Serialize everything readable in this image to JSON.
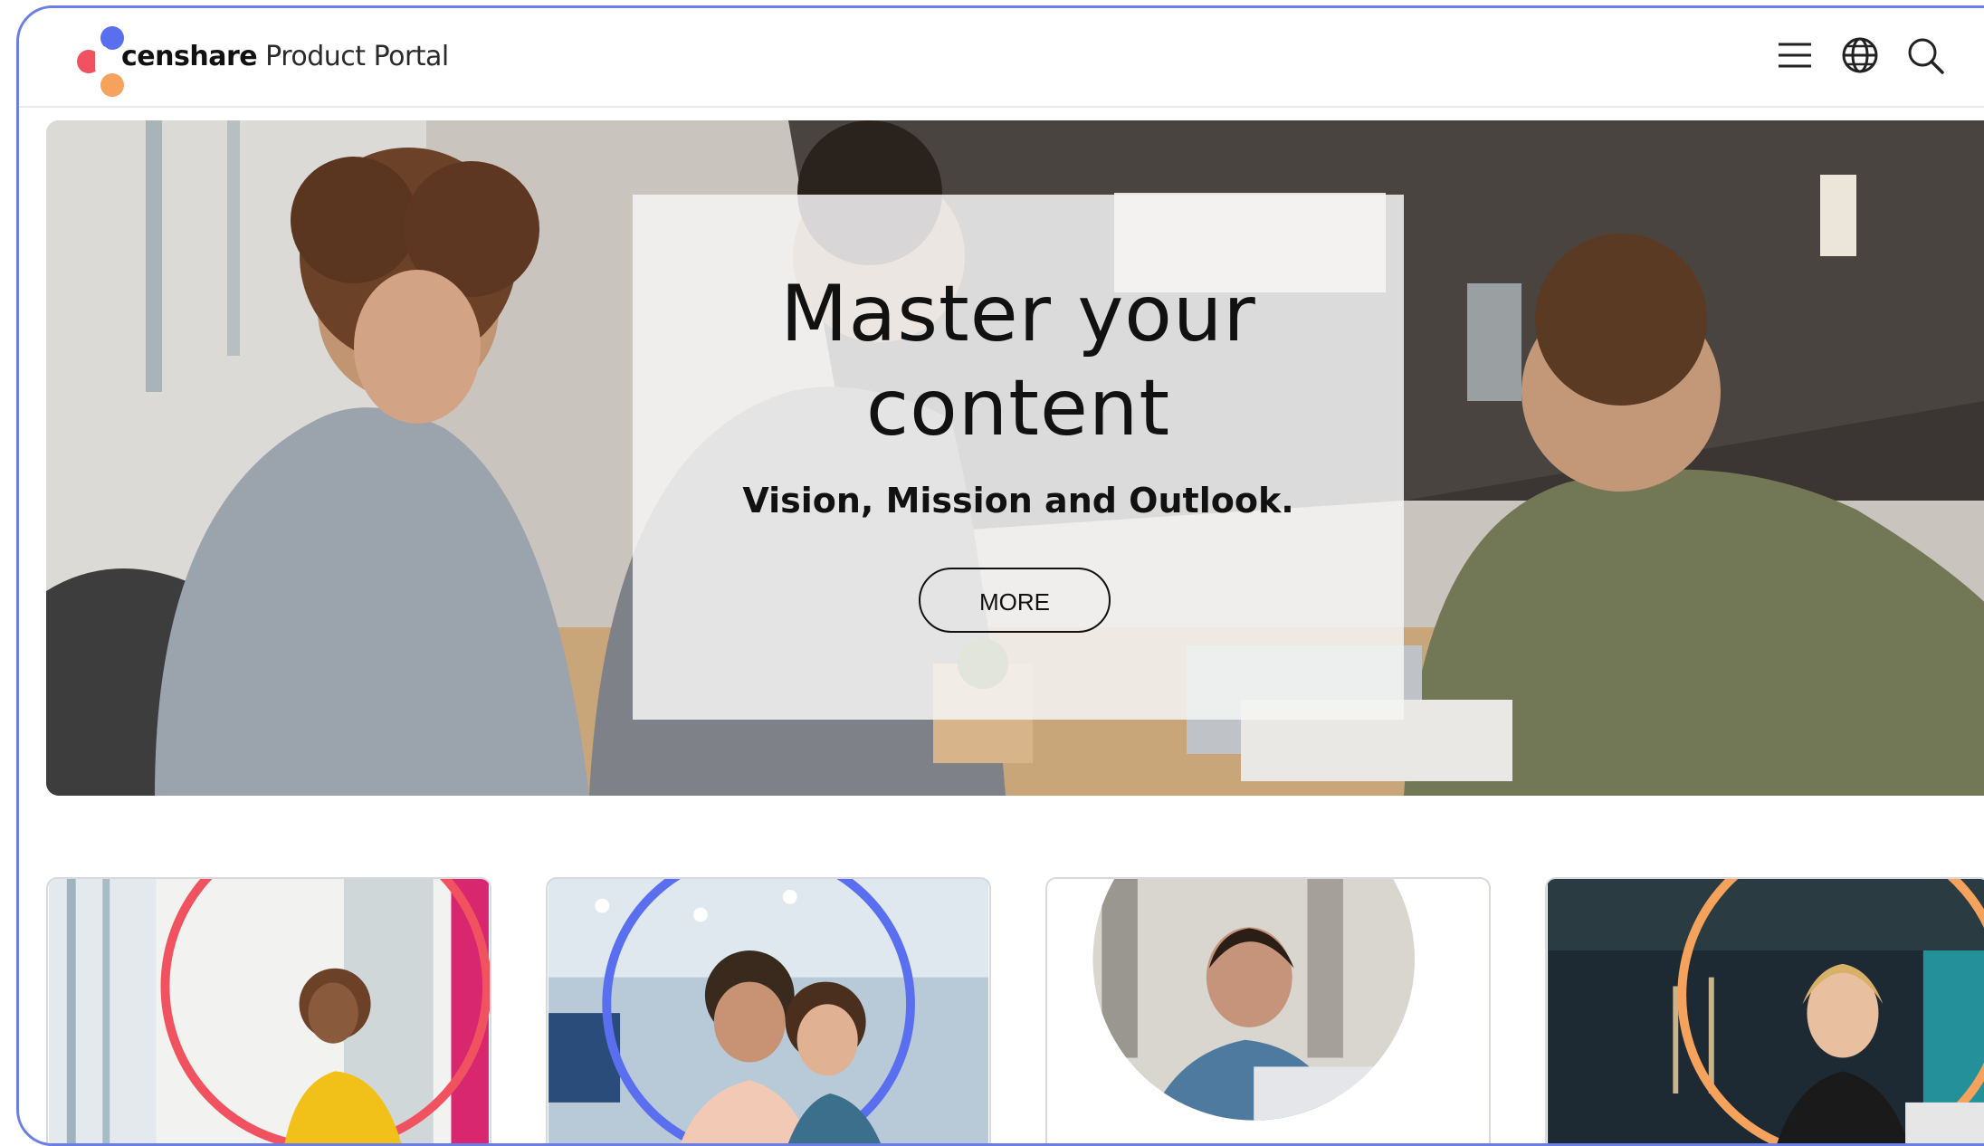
{
  "header": {
    "brand_bold": "censhare",
    "brand_light": " Product Portal",
    "icons": [
      "hamburger-menu-icon",
      "globe-icon",
      "search-icon"
    ]
  },
  "hero": {
    "title_line1": "Master your",
    "title_line2": "content",
    "subtitle": "Vision, Mission and Outlook.",
    "button_label": "MORE"
  },
  "tiles": [
    {
      "image": "woman-on-phone-photo",
      "accent": "#f0535f"
    },
    {
      "image": "couple-with-phone-photo",
      "accent": "#5a6ff0"
    },
    {
      "image": "man-with-laptop-photo",
      "accent": "#ffffff"
    },
    {
      "image": "woman-at-laptop-photo",
      "accent": "#f5a25c"
    }
  ],
  "colors": {
    "logo_blue": "#5a6ff0",
    "logo_red": "#f0535f",
    "logo_orange": "#f5a25c",
    "frame_border": "#6b7ee6"
  }
}
